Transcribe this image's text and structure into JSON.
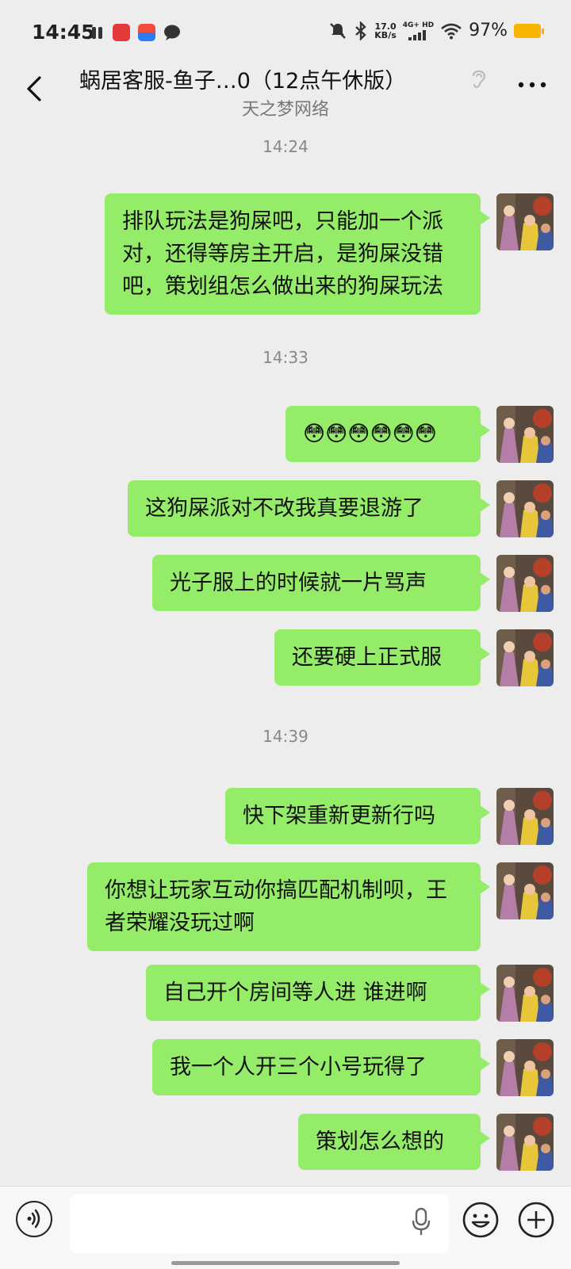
{
  "status_bar": {
    "time": "14:45",
    "net_speed_top": "17.0",
    "net_speed_bottom": "KB/s",
    "network": "4G+ HD",
    "battery": "97%"
  },
  "header": {
    "title": "蜗居客服-鱼子…0（12点午休版）",
    "subtitle": "天之梦网络"
  },
  "messages": [
    {
      "time": "14:24"
    },
    {
      "text": "排队玩法是狗屎吧，只能加一个派对，还得等房主开启，是狗屎没错吧，策划组怎么做出来的狗屎玩法"
    },
    {
      "time": "14:33"
    },
    {
      "text": "😳😳😳😳😳😳"
    },
    {
      "text": "这狗屎派对不改我真要退游了"
    },
    {
      "text": "光子服上的时候就一片骂声"
    },
    {
      "text": "还要硬上正式服"
    },
    {
      "time": "14:39"
    },
    {
      "text": "快下架重新更新行吗"
    },
    {
      "text": "你想让玩家互动你搞匹配机制呗，王者荣耀没玩过啊"
    },
    {
      "text": "自己开个房间等人进 谁进啊"
    },
    {
      "text": "我一个人开三个小号玩得了"
    },
    {
      "text": "策划怎么想的"
    }
  ],
  "input": {
    "value": ""
  },
  "colors": {
    "bubble": "#95ec69",
    "background": "#ededed",
    "battery": "#f7b500"
  },
  "icons": [
    "back-icon",
    "ear-icon",
    "more-icon",
    "voice-icon",
    "mic-icon",
    "emoji-icon",
    "plus-icon"
  ]
}
